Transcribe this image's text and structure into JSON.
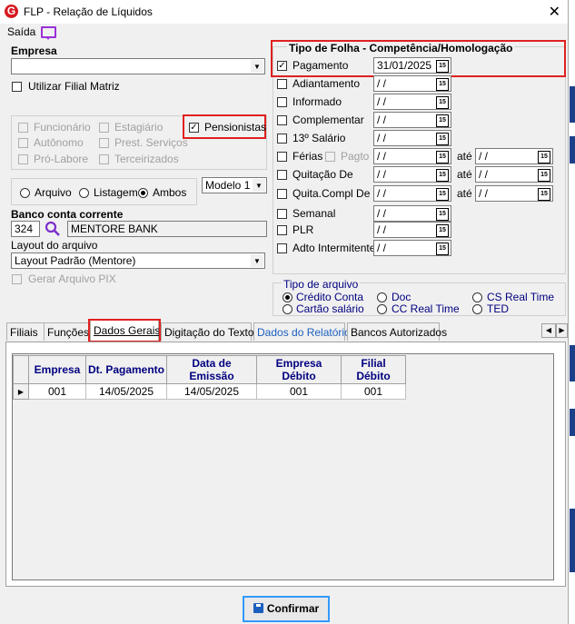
{
  "window": {
    "title": "FLP - Relação de Líquidos",
    "menu": "Saída"
  },
  "left": {
    "empresa_label": "Empresa",
    "empresa_value": "",
    "utilizar_filial": "Utilizar Filial Matriz",
    "checks": [
      "Funcionário",
      "Estagiário",
      "Autônomo",
      "Prest. Serviços",
      "Pró-Labore",
      "Terceirizados"
    ],
    "pensionistas": "Pensionistas",
    "radios": [
      "Arquivo",
      "Listagem",
      "Ambos"
    ],
    "modelo": "Modelo 1",
    "banco_label": "Banco conta corrente",
    "banco_codigo": "324",
    "banco_nome": "MENTORE BANK",
    "layout_label": "Layout do arquivo",
    "layout_value": "Layout Padrão (Mentore)",
    "gerar_pix": "Gerar Arquivo PIX"
  },
  "folha": {
    "title": "Tipo de Folha  -  Competência/Homologação",
    "pagamento": "Pagamento",
    "pagamento_date": "31/01/2025",
    "empty_date": " / /",
    "items": [
      "Adiantamento",
      "Informado",
      "Complementar",
      "13º Salário",
      "Férias",
      "Quitação De",
      "Quita.Compl De",
      "Semanal",
      "PLR",
      "Adto Intermitente"
    ],
    "pagto": "Pagto",
    "ate": "até"
  },
  "tipo_arquivo": {
    "title": "Tipo de arquivo",
    "options": [
      "Crédito Conta",
      "Doc",
      "CS Real Time",
      "Cartão salário",
      "CC Real Time",
      "TED"
    ]
  },
  "tabs": [
    "Filiais",
    "Funções",
    "Dados Gerais",
    "Digitação do Texto",
    "Dados do Relatório",
    "Bancos Autorizados"
  ],
  "grid": {
    "headers": [
      "Empresa",
      "Dt. Pagamento",
      "Data de Emissão",
      "Empresa Débito",
      "Filial Débito"
    ],
    "rows": [
      [
        "001",
        "14/05/2025",
        "14/05/2025",
        "001",
        "001"
      ]
    ]
  },
  "footer": {
    "confirmar": "Confirmar"
  },
  "icons": {
    "calendar": "15",
    "dropdown": "▼",
    "search": "magnifier-icon"
  }
}
